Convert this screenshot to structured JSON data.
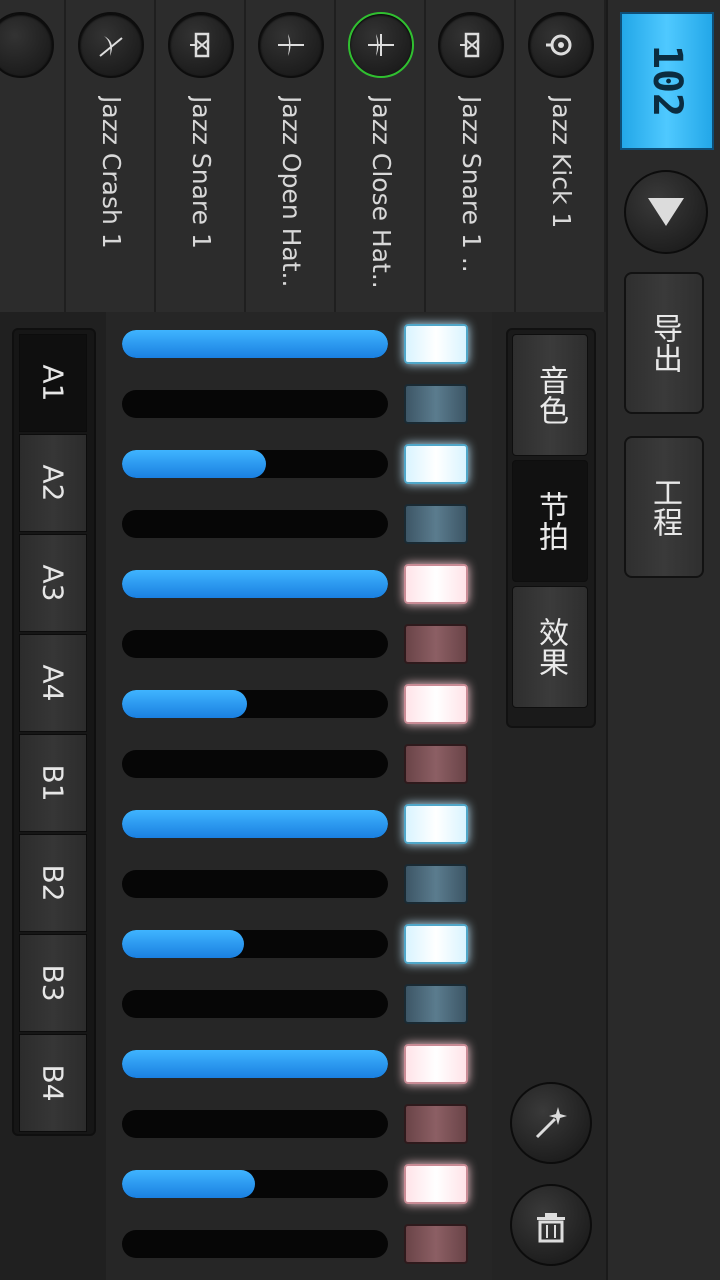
{
  "tempo": "102",
  "right_panel": {
    "export_label": "导出",
    "project_label": "工程"
  },
  "instruments": [
    {
      "name": "Jazz Kick 1",
      "icon": "kick-drum-icon",
      "selected": false
    },
    {
      "name": "Jazz Snare 1 ..",
      "icon": "snare-drum-icon",
      "selected": false
    },
    {
      "name": "Jazz Close Hat..",
      "icon": "closed-hihat-icon",
      "selected": true
    },
    {
      "name": "Jazz Open Hat..",
      "icon": "open-hihat-icon",
      "selected": false
    },
    {
      "name": "Jazz Snare 1",
      "icon": "snare-drum-icon",
      "selected": false
    },
    {
      "name": "Jazz Crash 1",
      "icon": "crash-cymbal-icon",
      "selected": false
    }
  ],
  "tabs": [
    {
      "label": "音色",
      "active": false
    },
    {
      "label": "节拍",
      "active": true
    },
    {
      "label": "效果",
      "active": false
    }
  ],
  "patterns": [
    {
      "label": "A1",
      "active": true
    },
    {
      "label": "A2",
      "active": false
    },
    {
      "label": "A3",
      "active": false
    },
    {
      "label": "A4",
      "active": false
    },
    {
      "label": "B1",
      "active": false
    },
    {
      "label": "B2",
      "active": false
    },
    {
      "label": "B3",
      "active": false
    },
    {
      "label": "B4",
      "active": false
    }
  ],
  "steps": [
    {
      "velocity": 1.0,
      "on": true,
      "color": "blue"
    },
    {
      "velocity": 0,
      "on": false,
      "color": "blue"
    },
    {
      "velocity": 0.54,
      "on": true,
      "color": "blue"
    },
    {
      "velocity": 0,
      "on": false,
      "color": "blue"
    },
    {
      "velocity": 1.0,
      "on": true,
      "color": "red"
    },
    {
      "velocity": 0,
      "on": false,
      "color": "red"
    },
    {
      "velocity": 0.47,
      "on": true,
      "color": "red"
    },
    {
      "velocity": 0,
      "on": false,
      "color": "red"
    },
    {
      "velocity": 1.0,
      "on": true,
      "color": "blue"
    },
    {
      "velocity": 0,
      "on": false,
      "color": "blue"
    },
    {
      "velocity": 0.46,
      "on": true,
      "color": "blue"
    },
    {
      "velocity": 0,
      "on": false,
      "color": "blue"
    },
    {
      "velocity": 1.0,
      "on": true,
      "color": "red"
    },
    {
      "velocity": 0,
      "on": false,
      "color": "red"
    },
    {
      "velocity": 0.5,
      "on": true,
      "color": "red"
    },
    {
      "velocity": 0,
      "on": false,
      "color": "red"
    }
  ],
  "colors": {
    "accent": "#2a9df4",
    "selected_ring": "#30c030",
    "tempo_bg": "#3bbcf8"
  }
}
